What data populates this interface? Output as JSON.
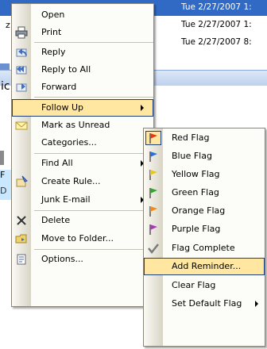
{
  "background": {
    "row_dates": [
      "Tue 2/27/2007 1:",
      "Tue 2/27/2007 1:",
      "Tue 2/27/2007 8:"
    ],
    "row_fragment": "z",
    "left_fragment": "ic",
    "follow_fragment_top": "F",
    "follow_fragment_bottom": "D",
    "selected_row_color": "#316ac5"
  },
  "menu": {
    "items": [
      {
        "label": "Open",
        "icon": "open-icon"
      },
      {
        "label": "Print",
        "icon": "printer-icon"
      },
      {
        "label": "Reply",
        "icon": "reply-icon"
      },
      {
        "label": "Reply to All",
        "icon": "reply-all-icon"
      },
      {
        "label": "Forward",
        "icon": "forward-icon"
      },
      {
        "label": "Follow Up",
        "icon": "",
        "highlighted": true,
        "has_submenu": true
      },
      {
        "label": "Mark as Unread",
        "icon": "envelope-icon"
      },
      {
        "label": "Categories...",
        "icon": ""
      },
      {
        "label": "Find All",
        "icon": "",
        "has_submenu": true
      },
      {
        "label": "Create Rule...",
        "icon": "rule-icon"
      },
      {
        "label": "Junk E-mail",
        "icon": "",
        "has_submenu": true
      },
      {
        "label": "Delete",
        "icon": "delete-x-icon"
      },
      {
        "label": "Move to Folder...",
        "icon": "move-folder-icon"
      },
      {
        "label": "Options...",
        "icon": "options-icon"
      }
    ]
  },
  "submenu": {
    "items": [
      {
        "label": "Red Flag",
        "icon": "red-flag-icon",
        "color": "#e03a1a"
      },
      {
        "label": "Blue Flag",
        "icon": "blue-flag-icon",
        "color": "#2a6fd8"
      },
      {
        "label": "Yellow Flag",
        "icon": "yellow-flag-icon",
        "color": "#e8c820"
      },
      {
        "label": "Green Flag",
        "icon": "green-flag-icon",
        "color": "#2fa82a"
      },
      {
        "label": "Orange Flag",
        "icon": "orange-flag-icon",
        "color": "#f08a18"
      },
      {
        "label": "Purple Flag",
        "icon": "purple-flag-icon",
        "color": "#a83ab8"
      },
      {
        "label": "Flag Complete",
        "icon": "checkmark-icon"
      },
      {
        "label": "Add Reminder...",
        "icon": "",
        "highlighted": true
      },
      {
        "label": "Clear Flag",
        "icon": ""
      },
      {
        "label": "Set Default Flag",
        "icon": "",
        "has_submenu": true
      }
    ]
  },
  "colors": {
    "highlight": "#ffe7a2",
    "highlight_border": "#1f3f7a",
    "accent": "#316ac5"
  }
}
